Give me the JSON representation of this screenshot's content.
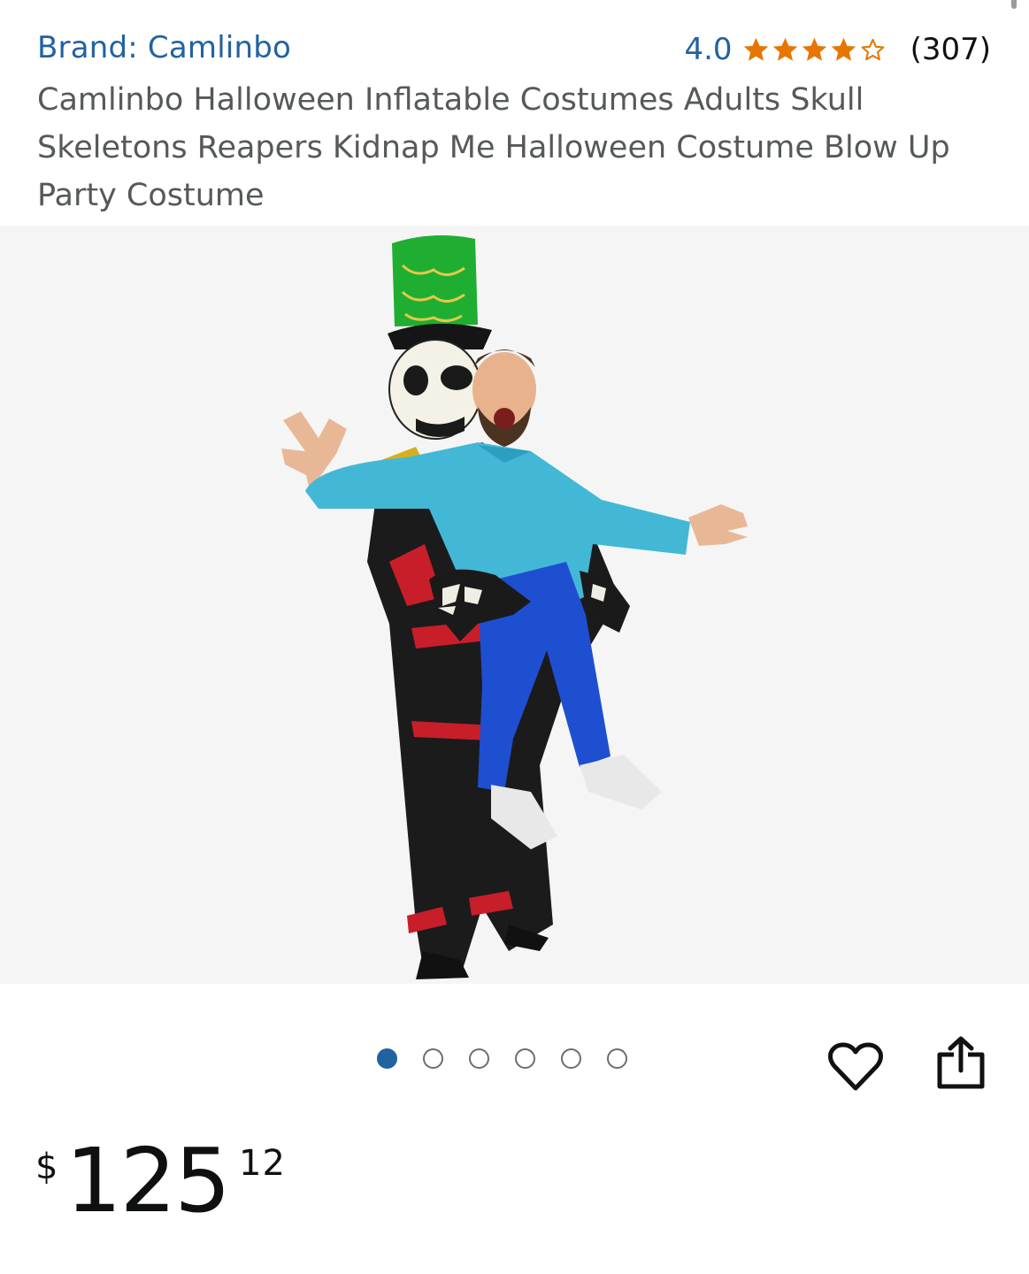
{
  "product": {
    "brand_label": "Brand: Camlinbo",
    "rating_value": "4.0",
    "rating_stars": 4,
    "rating_max": 5,
    "rating_count": "(307)",
    "title": "Camlinbo Halloween Inflatable Costumes Adults Skull Skeletons Reapers Kidnap Me Halloween Costume Blow Up Party Costume",
    "image_count": 6,
    "image_active_index": 0
  },
  "price": {
    "symbol": "$",
    "whole": "125",
    "fraction": "12"
  },
  "icons": {
    "wishlist": "heart-outline-icon",
    "share": "share-icon",
    "star_full": "star-filled-icon",
    "star_empty": "star-outline-icon"
  },
  "colors": {
    "link": "#2162a1",
    "star": "#e77600",
    "dot_active": "#2162a1",
    "title_text": "#565959"
  }
}
